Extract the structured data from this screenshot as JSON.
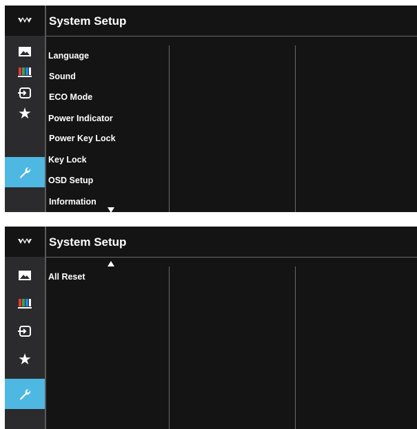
{
  "colors": {
    "background": "#141414",
    "sidebar": "#2b2b2d",
    "accent": "#4fb8e2",
    "text": "#ffffff"
  },
  "icons": [
    "tuf-logo-icon",
    "image-icon",
    "color-bars-icon",
    "input-icon",
    "star-icon",
    "wrench-icon"
  ],
  "panels": [
    {
      "title": "System Setup",
      "scroll_indicator": "down",
      "items": [
        {
          "label": "Language"
        },
        {
          "label": "Sound"
        },
        {
          "label": "ECO Mode"
        },
        {
          "label": "Power Indicator"
        },
        {
          "label": "Power Key Lock"
        },
        {
          "label": "Key Lock"
        },
        {
          "label": "OSD Setup"
        },
        {
          "label": "Information"
        }
      ]
    },
    {
      "title": "System Setup",
      "scroll_indicator": "up",
      "items": [
        {
          "label": "All Reset"
        }
      ]
    }
  ]
}
